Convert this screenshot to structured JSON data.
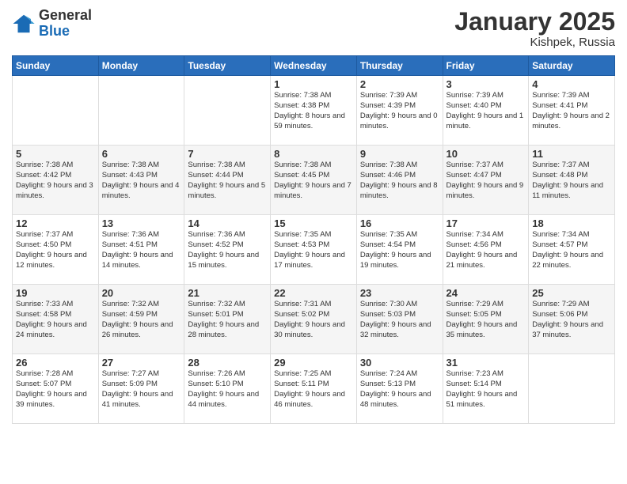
{
  "header": {
    "logo_general": "General",
    "logo_blue": "Blue",
    "month_title": "January 2025",
    "location": "Kishpek, Russia"
  },
  "weekdays": [
    "Sunday",
    "Monday",
    "Tuesday",
    "Wednesday",
    "Thursday",
    "Friday",
    "Saturday"
  ],
  "weeks": [
    [
      {
        "day": "",
        "info": ""
      },
      {
        "day": "",
        "info": ""
      },
      {
        "day": "",
        "info": ""
      },
      {
        "day": "1",
        "info": "Sunrise: 7:38 AM\nSunset: 4:38 PM\nDaylight: 8 hours and 59 minutes."
      },
      {
        "day": "2",
        "info": "Sunrise: 7:39 AM\nSunset: 4:39 PM\nDaylight: 9 hours and 0 minutes."
      },
      {
        "day": "3",
        "info": "Sunrise: 7:39 AM\nSunset: 4:40 PM\nDaylight: 9 hours and 1 minute."
      },
      {
        "day": "4",
        "info": "Sunrise: 7:39 AM\nSunset: 4:41 PM\nDaylight: 9 hours and 2 minutes."
      }
    ],
    [
      {
        "day": "5",
        "info": "Sunrise: 7:38 AM\nSunset: 4:42 PM\nDaylight: 9 hours and 3 minutes."
      },
      {
        "day": "6",
        "info": "Sunrise: 7:38 AM\nSunset: 4:43 PM\nDaylight: 9 hours and 4 minutes."
      },
      {
        "day": "7",
        "info": "Sunrise: 7:38 AM\nSunset: 4:44 PM\nDaylight: 9 hours and 5 minutes."
      },
      {
        "day": "8",
        "info": "Sunrise: 7:38 AM\nSunset: 4:45 PM\nDaylight: 9 hours and 7 minutes."
      },
      {
        "day": "9",
        "info": "Sunrise: 7:38 AM\nSunset: 4:46 PM\nDaylight: 9 hours and 8 minutes."
      },
      {
        "day": "10",
        "info": "Sunrise: 7:37 AM\nSunset: 4:47 PM\nDaylight: 9 hours and 9 minutes."
      },
      {
        "day": "11",
        "info": "Sunrise: 7:37 AM\nSunset: 4:48 PM\nDaylight: 9 hours and 11 minutes."
      }
    ],
    [
      {
        "day": "12",
        "info": "Sunrise: 7:37 AM\nSunset: 4:50 PM\nDaylight: 9 hours and 12 minutes."
      },
      {
        "day": "13",
        "info": "Sunrise: 7:36 AM\nSunset: 4:51 PM\nDaylight: 9 hours and 14 minutes."
      },
      {
        "day": "14",
        "info": "Sunrise: 7:36 AM\nSunset: 4:52 PM\nDaylight: 9 hours and 15 minutes."
      },
      {
        "day": "15",
        "info": "Sunrise: 7:35 AM\nSunset: 4:53 PM\nDaylight: 9 hours and 17 minutes."
      },
      {
        "day": "16",
        "info": "Sunrise: 7:35 AM\nSunset: 4:54 PM\nDaylight: 9 hours and 19 minutes."
      },
      {
        "day": "17",
        "info": "Sunrise: 7:34 AM\nSunset: 4:56 PM\nDaylight: 9 hours and 21 minutes."
      },
      {
        "day": "18",
        "info": "Sunrise: 7:34 AM\nSunset: 4:57 PM\nDaylight: 9 hours and 22 minutes."
      }
    ],
    [
      {
        "day": "19",
        "info": "Sunrise: 7:33 AM\nSunset: 4:58 PM\nDaylight: 9 hours and 24 minutes."
      },
      {
        "day": "20",
        "info": "Sunrise: 7:32 AM\nSunset: 4:59 PM\nDaylight: 9 hours and 26 minutes."
      },
      {
        "day": "21",
        "info": "Sunrise: 7:32 AM\nSunset: 5:01 PM\nDaylight: 9 hours and 28 minutes."
      },
      {
        "day": "22",
        "info": "Sunrise: 7:31 AM\nSunset: 5:02 PM\nDaylight: 9 hours and 30 minutes."
      },
      {
        "day": "23",
        "info": "Sunrise: 7:30 AM\nSunset: 5:03 PM\nDaylight: 9 hours and 32 minutes."
      },
      {
        "day": "24",
        "info": "Sunrise: 7:29 AM\nSunset: 5:05 PM\nDaylight: 9 hours and 35 minutes."
      },
      {
        "day": "25",
        "info": "Sunrise: 7:29 AM\nSunset: 5:06 PM\nDaylight: 9 hours and 37 minutes."
      }
    ],
    [
      {
        "day": "26",
        "info": "Sunrise: 7:28 AM\nSunset: 5:07 PM\nDaylight: 9 hours and 39 minutes."
      },
      {
        "day": "27",
        "info": "Sunrise: 7:27 AM\nSunset: 5:09 PM\nDaylight: 9 hours and 41 minutes."
      },
      {
        "day": "28",
        "info": "Sunrise: 7:26 AM\nSunset: 5:10 PM\nDaylight: 9 hours and 44 minutes."
      },
      {
        "day": "29",
        "info": "Sunrise: 7:25 AM\nSunset: 5:11 PM\nDaylight: 9 hours and 46 minutes."
      },
      {
        "day": "30",
        "info": "Sunrise: 7:24 AM\nSunset: 5:13 PM\nDaylight: 9 hours and 48 minutes."
      },
      {
        "day": "31",
        "info": "Sunrise: 7:23 AM\nSunset: 5:14 PM\nDaylight: 9 hours and 51 minutes."
      },
      {
        "day": "",
        "info": ""
      }
    ]
  ]
}
